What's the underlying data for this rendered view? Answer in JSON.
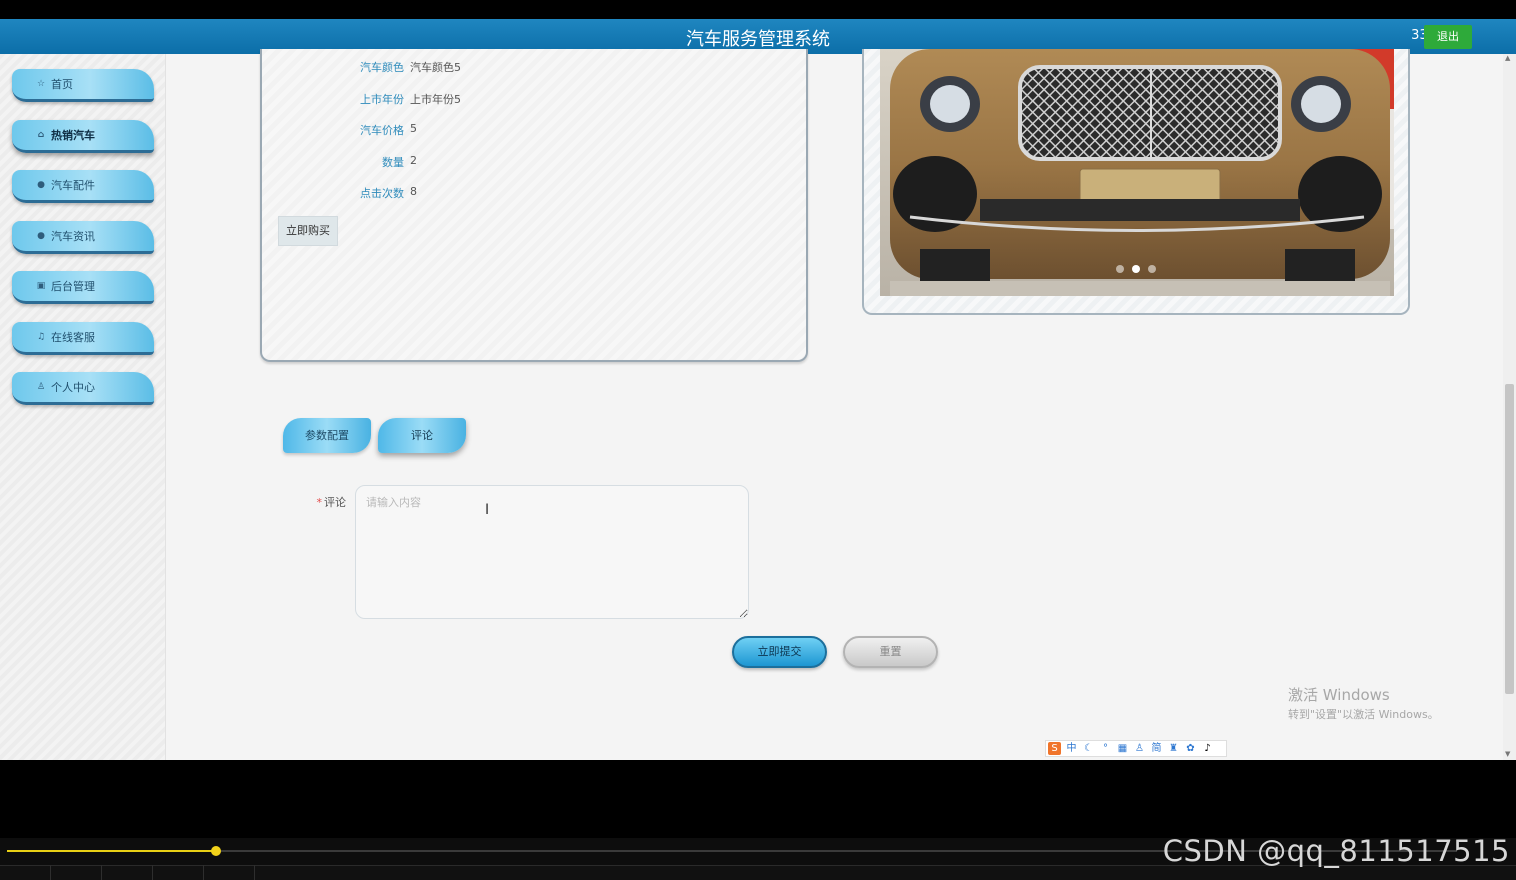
{
  "header": {
    "title": "汽车服务管理系统",
    "username": "333",
    "logout_label": "退出"
  },
  "sidebar": {
    "items": [
      {
        "label": "首页",
        "icon": "star-icon"
      },
      {
        "label": "热销汽车",
        "icon": "bag-icon",
        "active": true
      },
      {
        "label": "汽车配件",
        "icon": "info-icon"
      },
      {
        "label": "汽车资讯",
        "icon": "question-icon"
      },
      {
        "label": "后台管理",
        "icon": "calendar-icon"
      },
      {
        "label": "在线客服",
        "icon": "headset-icon"
      },
      {
        "label": "个人中心",
        "icon": "user-icon"
      }
    ]
  },
  "detail": {
    "rows": [
      {
        "label": "汽车颜色",
        "value": "汽车颜色5"
      },
      {
        "label": "上市年份",
        "value": "上市年份5"
      },
      {
        "label": "汽车价格",
        "value": "5"
      },
      {
        "label": "数量",
        "value": "2"
      },
      {
        "label": "点击次数",
        "value": "8"
      }
    ],
    "buy_label": "立即购买"
  },
  "carousel": {
    "active_index": 1,
    "count": 3
  },
  "tabs": [
    {
      "label": "参数配置"
    },
    {
      "label": "评论",
      "active": true
    }
  ],
  "comment_form": {
    "label": "评论",
    "required_mark": "*",
    "placeholder": "请输入内容",
    "submit_label": "立即提交",
    "reset_label": "重置"
  },
  "watermark": {
    "title": "激活 Windows",
    "subtitle": "转到\"设置\"以激活 Windows。"
  },
  "ime_bar": {
    "char": "中",
    "simplified": "简"
  },
  "player": {
    "progress": 0.144
  },
  "csdn_mark": "CSDN @qq_811517515",
  "colors": {
    "header": "#1a80bb",
    "accent": "#5bbde6",
    "success": "#2eaa3a",
    "progress": "#e8cf15"
  }
}
